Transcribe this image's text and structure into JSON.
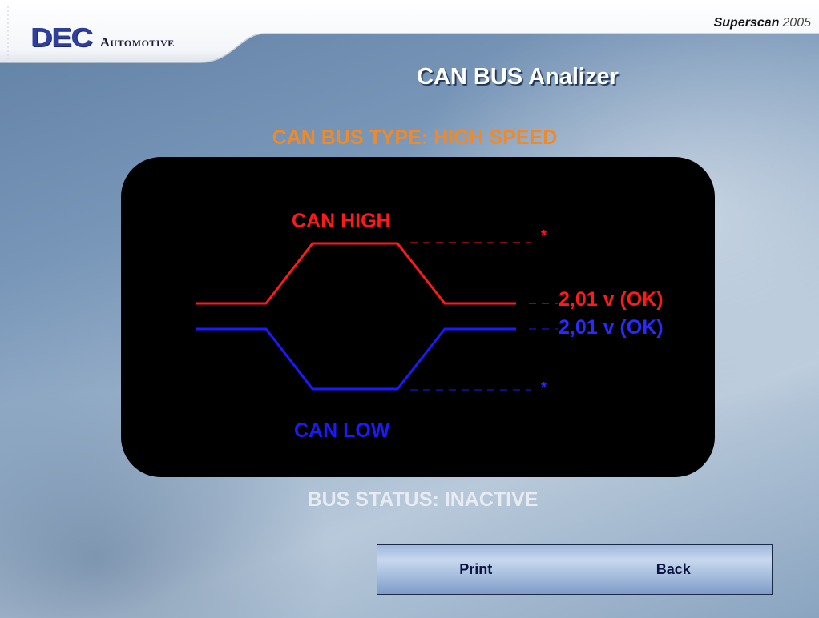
{
  "header": {
    "brand": "DEC",
    "brand_sub": "Automotive",
    "product": "Superscan",
    "product_year": "2005"
  },
  "page": {
    "title": "CAN BUS Analizer",
    "bus_type": "CAN BUS TYPE: HIGH SPEED",
    "bus_status": "BUS STATUS: INACTIVE"
  },
  "scope": {
    "can_high_label": "CAN HIGH",
    "can_low_label": "CAN LOW",
    "can_high_voltage": "2,01 v (OK)",
    "can_low_voltage": "2,01 v (OK)",
    "high_marker": "*",
    "low_marker": "*",
    "colors": {
      "high": "#ff1a1a",
      "low": "#1a1aff"
    }
  },
  "buttons": {
    "print": "Print",
    "back": "Back"
  }
}
